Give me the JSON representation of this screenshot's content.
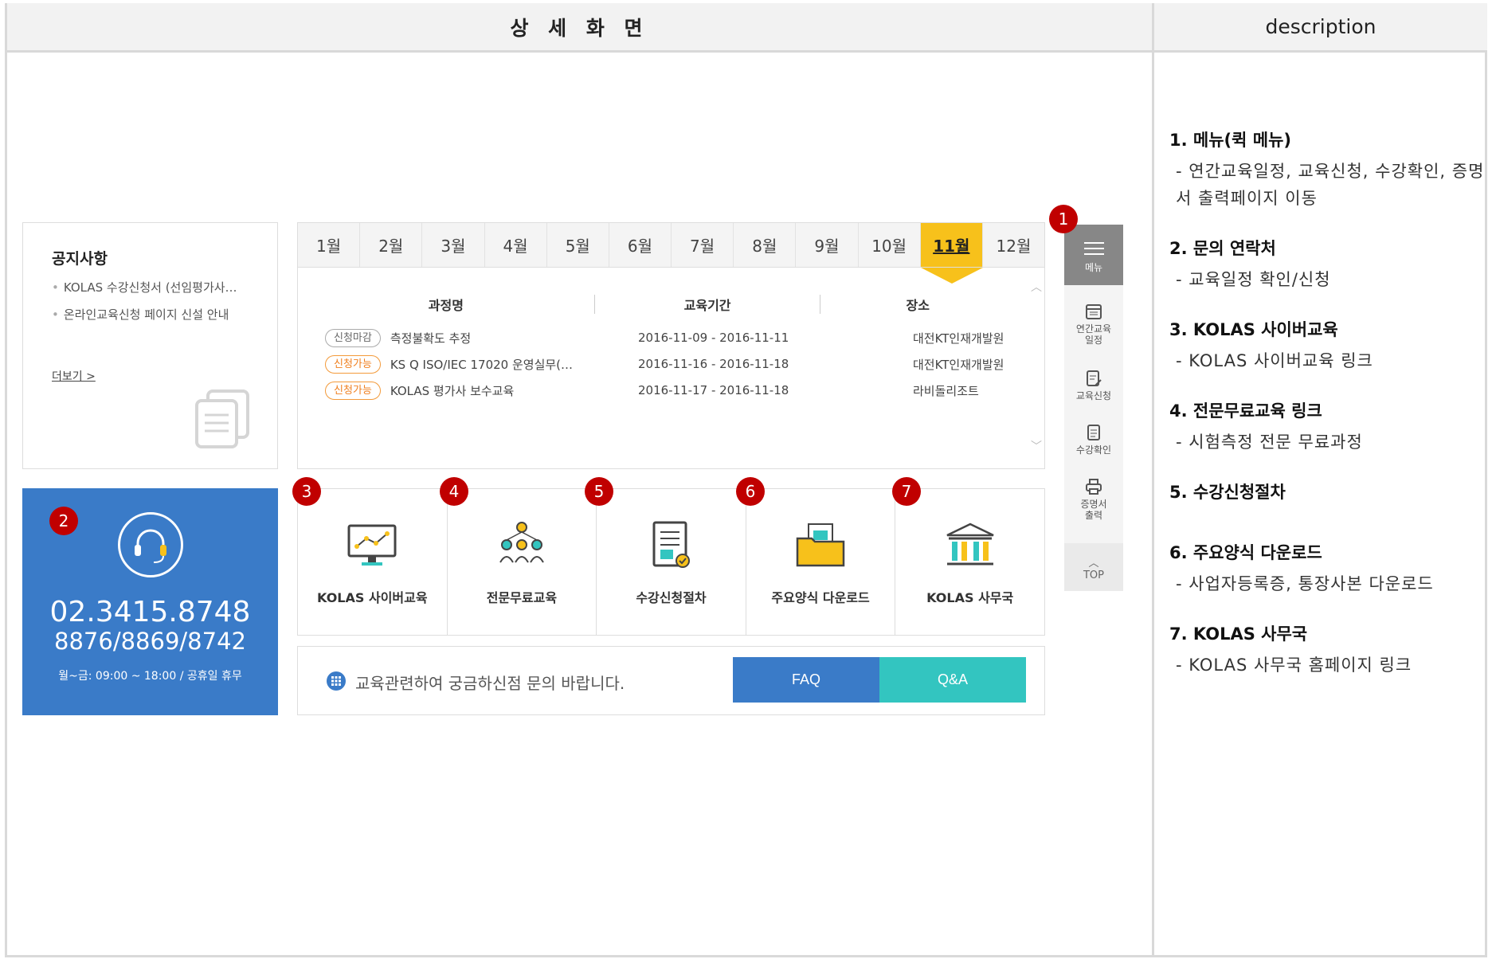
{
  "header": {
    "left_title": "상 세 화 면",
    "right_title": "description"
  },
  "notice": {
    "title": "공지사항",
    "items": [
      "KOLAS 수강신청서 (선임평가사…",
      "온라인교육신청 페이지 신설 안내"
    ],
    "more": "더보기 >"
  },
  "contact": {
    "phone": "02.3415.8748",
    "extensions": "8876/8869/8742",
    "hours": "월~금: 09:00 ~ 18:00 / 공휴일 휴무"
  },
  "calendar": {
    "months": [
      "1월",
      "2월",
      "3월",
      "4월",
      "5월",
      "6월",
      "7월",
      "8월",
      "9월",
      "10월",
      "11월",
      "12월"
    ],
    "active_month": "11월",
    "headers": [
      "과정명",
      "교육기간",
      "장소"
    ],
    "rows": [
      {
        "status": "신청마감",
        "name": "측정불확도 추정",
        "period": "2016-11-09 - 2016-11-11",
        "place": "대전KT인재개발원"
      },
      {
        "status": "신청가능",
        "name": "KS Q ISO/IEC 17020 운영실무(…",
        "period": "2016-11-16 - 2016-11-18",
        "place": "대전KT인재개발원"
      },
      {
        "status": "신청가능",
        "name": "KOLAS 평가사 보수교육",
        "period": "2016-11-17 - 2016-11-18",
        "place": "라비돌리조트"
      }
    ]
  },
  "shortcuts": [
    "KOLAS 사이버교육",
    "전문무료교육",
    "수강신청절차",
    "주요양식 다운로드",
    "KOLAS 사무국"
  ],
  "inquiry": {
    "text": "교육관련하여 궁금하신점 문의 바랍니다.",
    "faq": "FAQ",
    "qa": "Q&A"
  },
  "quick_menu": {
    "menu": "메뉴",
    "schedule": "연간교육\n일정",
    "apply": "교육신청",
    "confirm": "수강확인",
    "certificate": "증명서\n출력",
    "top": "TOP"
  },
  "markers": [
    "1",
    "2",
    "3",
    "4",
    "5",
    "6",
    "7"
  ],
  "description": [
    {
      "title": "1. 메뉴(퀵 메뉴)",
      "sub": "- 연간교육일정, 교육신청, 수강확인, 증명서 출력페이지 이동"
    },
    {
      "title": "2. 문의 연락처",
      "sub": "- 교육일정 확인/신청"
    },
    {
      "title": "3. KOLAS 사이버교육",
      "sub": "- KOLAS 사이버교육 링크"
    },
    {
      "title": "4. 전문무료교육 링크",
      "sub": "- 시험측정 전문 무료과정"
    },
    {
      "title": "5. 수강신청절차",
      "sub": ""
    },
    {
      "title": "6. 주요양식 다운로드",
      "sub": "- 사업자등록증, 통장사본 다운로드"
    },
    {
      "title": "7. KOLAS 사무국",
      "sub": "- KOLAS 사무국 홈페이지 링크"
    }
  ],
  "colors": {
    "blue": "#3a7bc8",
    "teal": "#33c5c0",
    "yellow": "#f7c11b",
    "marker": "#c00000"
  }
}
